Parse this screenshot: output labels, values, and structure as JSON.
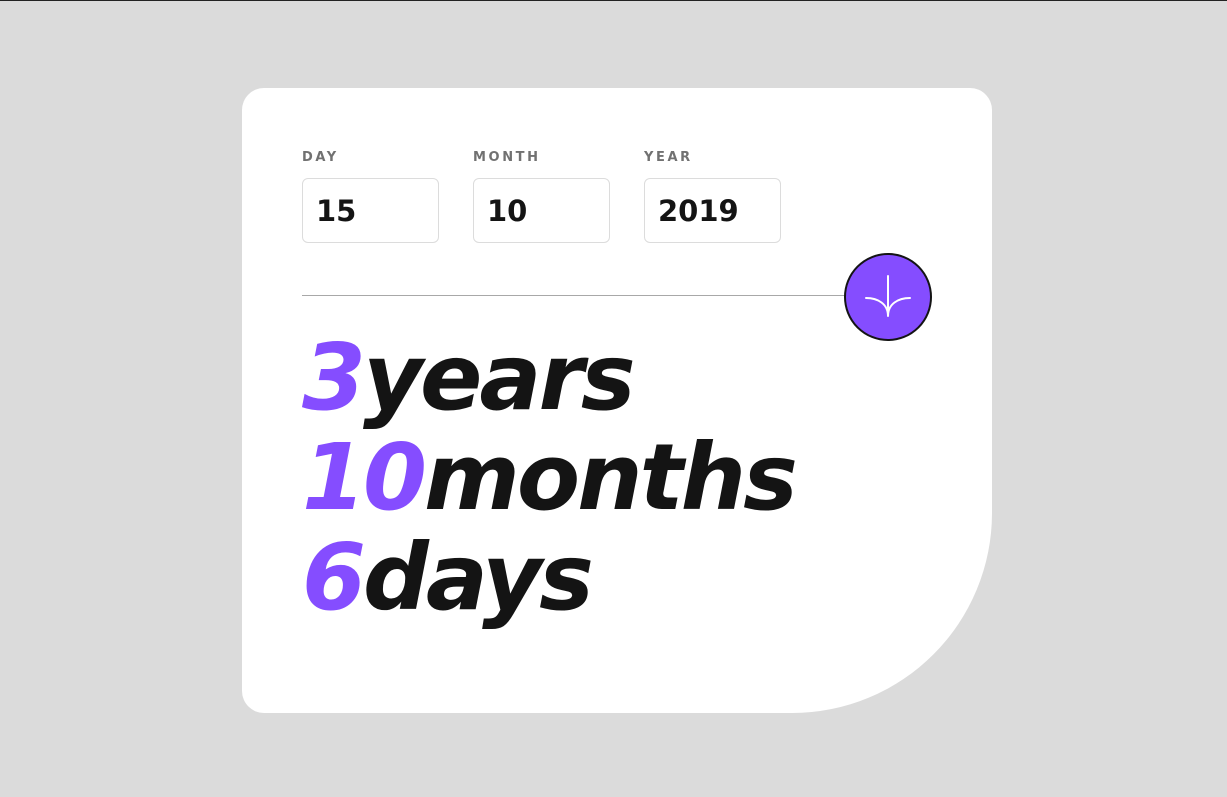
{
  "inputs": {
    "day": {
      "label": "DAY",
      "value": "15"
    },
    "month": {
      "label": "MONTH",
      "value": "10"
    },
    "year": {
      "label": "YEAR",
      "value": "2019"
    }
  },
  "results": {
    "years": {
      "value": "3",
      "unit": "years"
    },
    "months": {
      "value": "10",
      "unit": "months"
    },
    "days": {
      "value": "6",
      "unit": "days"
    }
  },
  "submit": {
    "icon": "arrow-down-icon"
  },
  "colors": {
    "accent": "#854dff",
    "background": "#dbdbdb",
    "card": "#ffffff",
    "text": "#141414",
    "label": "#717171",
    "border": "#dcdcdc"
  }
}
